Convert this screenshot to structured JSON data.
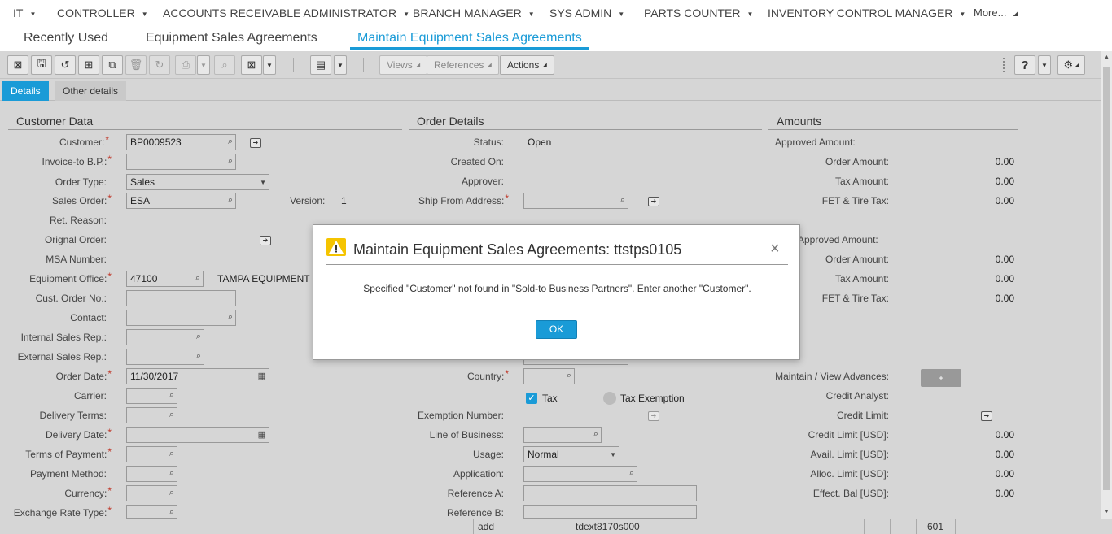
{
  "topnav": {
    "menus": [
      "IT",
      "CONTROLLER",
      "ACCOUNTS RECEIVABLE ADMINISTRATOR",
      "BRANCH MANAGER",
      "SYS ADMIN",
      "PARTS COUNTER",
      "INVENTORY CONTROL MANAGER"
    ],
    "more": "More..."
  },
  "pagetabs": {
    "recent": "Recently Used",
    "tab1": "Equipment Sales Agreements",
    "tab2": "Maintain Equipment Sales Agreements"
  },
  "toolbar": {
    "views": "Views",
    "references": "References",
    "actions": "Actions",
    "help": "?",
    "icons": [
      "save-and-close",
      "save",
      "undo",
      "new",
      "copy",
      "delete",
      "refresh",
      "print",
      "find",
      "export",
      "calendar",
      "gear"
    ]
  },
  "subtabs": {
    "details": "Details",
    "other": "Other details"
  },
  "customer": {
    "section": "Customer Data",
    "labels": {
      "customer": "Customer:",
      "invoice_to": "Invoice-to B.P.:",
      "order_type": "Order Type:",
      "sales_order": "Sales Order:",
      "ret_reason": "Ret. Reason:",
      "orignal_order": "Orignal Order:",
      "msa_number": "MSA Number:",
      "equipment_office": "Equipment Office:",
      "cust_order_no": "Cust. Order No.:",
      "contact": "Contact:",
      "internal_rep": "Internal Sales Rep.:",
      "external_rep": "External Sales Rep.:",
      "order_date": "Order Date:",
      "carrier": "Carrier:",
      "delivery_terms": "Delivery Terms:",
      "delivery_date": "Delivery Date:",
      "terms_payment": "Terms of Payment:",
      "payment_method": "Payment Method:",
      "currency": "Currency:",
      "exchange_rate": "Exchange Rate Type:",
      "version": "Version:"
    },
    "values": {
      "customer": "BP0009523",
      "order_type": "Sales",
      "sales_order": "ESA",
      "version": "1",
      "equipment_office": "47100",
      "equipment_office_desc": "TAMPA EQUIPMENT C",
      "order_date": "11/30/2017"
    }
  },
  "order": {
    "section": "Order Details",
    "labels": {
      "status": "Status:",
      "created_on": "Created On:",
      "approver": "Approver:",
      "ship_from": "Ship From Address:",
      "country": "Country:",
      "tax": "Tax",
      "tax_exemption": "Tax Exemption",
      "exemption_number": "Exemption Number:",
      "line_business": "Line of Business:",
      "usage": "Usage:",
      "application": "Application:",
      "reference_a": "Reference A:",
      "reference_b": "Reference B:"
    },
    "values": {
      "status": "Open",
      "usage": "Normal"
    }
  },
  "amounts": {
    "section": "Amounts",
    "labels": {
      "approved_amount": "Approved Amount:",
      "order_amount": "Order Amount:",
      "tax_amount": "Tax Amount:",
      "fet_tire": "FET & Tire Tax:",
      "approved_amount2": "Approved Amount:",
      "maintain_advances": "Maintain / View Advances:",
      "credit_analyst": "Credit Analyst:",
      "credit_limit": "Credit Limit:",
      "credit_limit_usd": "Credit Limit [USD]:",
      "avail_limit": "Avail. Limit [USD]:",
      "alloc_limit": "Alloc. Limit [USD]:",
      "effect_bal": "Effect. Bal [USD]:"
    },
    "values": {
      "zero": "0.00",
      "plus": "+"
    }
  },
  "dialog": {
    "title": "Maintain Equipment Sales Agreements: ttstps0105",
    "message": "Specified \"Customer\" not found in \"Sold-to Business Partners\". Enter another \"Customer\".",
    "ok": "OK",
    "close": "×"
  },
  "statusbar": {
    "mode": "add",
    "session": "tdext8170s000",
    "company": "601"
  }
}
